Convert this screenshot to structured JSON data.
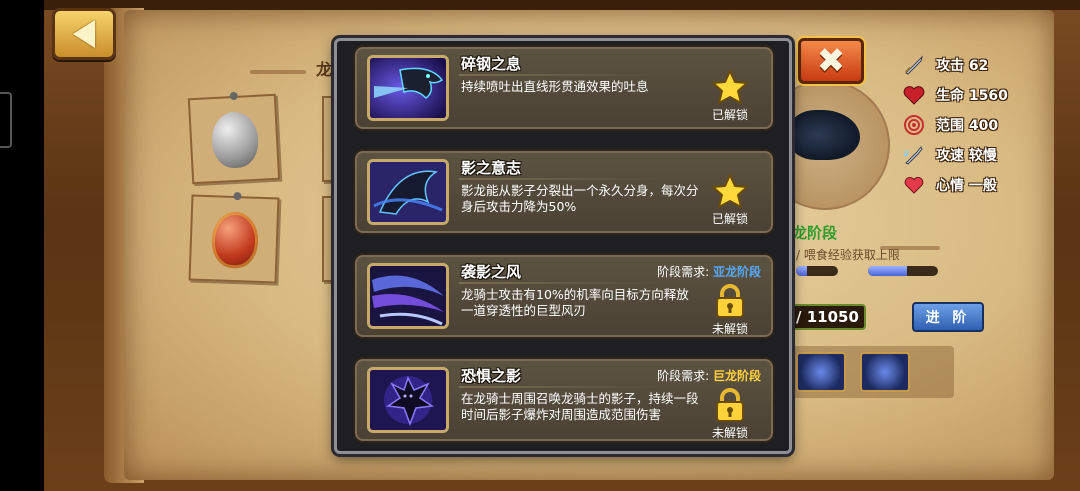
{
  "header": {
    "title_partial": "龙"
  },
  "close": {
    "label": "✖"
  },
  "stats": [
    {
      "icon": "sword-icon",
      "text": "攻击 62"
    },
    {
      "icon": "heart-icon",
      "text": "生命 1560"
    },
    {
      "icon": "target-icon",
      "text": "范围 400"
    },
    {
      "icon": "speed-icon",
      "text": "攻速 较慢"
    },
    {
      "icon": "mood-heart-icon",
      "text": "心情 一般"
    }
  ],
  "background_panel": {
    "stage_title_partial": "龙阶段",
    "stage_note_partial": "/ 喂食经验获取上限",
    "exp_value": "/ 11050",
    "advance_label": "进 阶",
    "progress": [
      0.25,
      0.55
    ]
  },
  "skills": [
    {
      "name": "碎钢之息",
      "desc": "持续喷吐出直线形贯通效果的吐息",
      "status": "已解锁",
      "state": "unlocked",
      "icon": "dragon-breath-icon"
    },
    {
      "name": "影之意志",
      "desc": "影龙能从影子分裂出一个永久分身，每次分身后攻击力降为50%",
      "status": "已解锁",
      "state": "unlocked",
      "icon": "shadow-dragon-icon"
    },
    {
      "name": "袭影之风",
      "desc": "龙骑士攻击有10%的机率向目标方向释放一道穿透性的巨型风刃",
      "req_label": "阶段需求:",
      "req_stage": "亚龙阶段",
      "req_color": "#55a8ff",
      "status": "未解锁",
      "state": "locked",
      "icon": "shadow-wind-icon"
    },
    {
      "name": "恐惧之影",
      "desc": "在龙骑士周围召唤龙骑士的影子，持续一段时间后影子爆炸对周围造成范围伤害",
      "req_label": "阶段需求:",
      "req_stage": "巨龙阶段",
      "req_color": "#ffd23c",
      "status": "未解锁",
      "state": "locked",
      "icon": "fear-shadow-icon"
    }
  ]
}
